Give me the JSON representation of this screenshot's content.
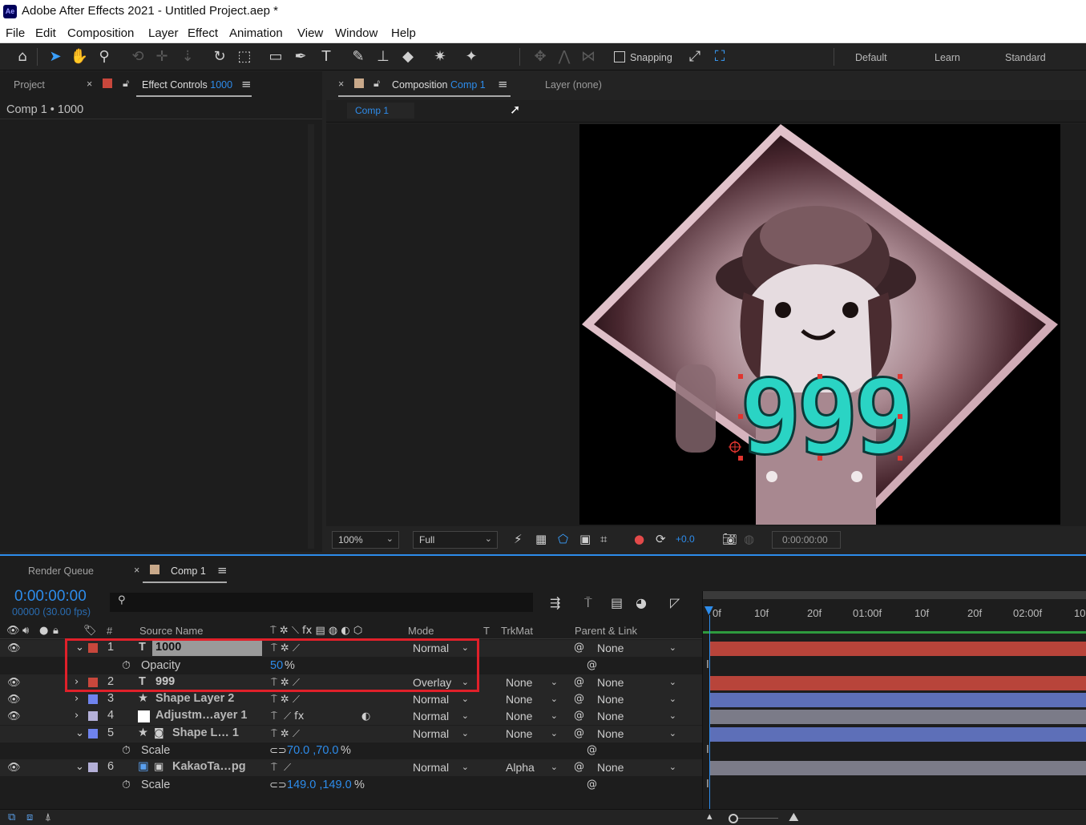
{
  "app": {
    "title": "Adobe After Effects 2021 - Untitled Project.aep *",
    "icon_label": "Ae"
  },
  "menu": [
    "File",
    "Edit",
    "Composition",
    "Layer",
    "Effect",
    "Animation",
    "View",
    "Window",
    "Help"
  ],
  "toolbar": {
    "snapping_label": "Snapping",
    "workspaces": [
      "Default",
      "Learn",
      "Standard"
    ]
  },
  "left_panel": {
    "tab_project": "Project",
    "tab_effect_controls": "Effect Controls",
    "effect_controls_target": "1000",
    "content_title": "Comp 1 • 1000",
    "label_color": "#c8473c"
  },
  "comp_panel": {
    "tab_composition": "Composition",
    "comp_name": "Comp 1",
    "tab_layer": "Layer (none)",
    "subtab": "Comp 1",
    "zoom": "100%",
    "resolution": "Full",
    "exposure": "+0.0",
    "timecode": "0:00:00:00",
    "label_color": "#c9a98a",
    "overlay_text": "999"
  },
  "timeline": {
    "tab_render_queue": "Render Queue",
    "tab_comp": "Comp 1",
    "current_time": "0:00:00:00",
    "frame_info": "00000 (30.00 fps)",
    "search_placeholder": "",
    "columns": {
      "number": "#",
      "source_name": "Source Name",
      "mode": "Mode",
      "t": "T",
      "trkmat": "TrkMat",
      "parent": "Parent & Link"
    },
    "ruler": [
      "0f",
      "10f",
      "20f",
      "01:00f",
      "10f",
      "20f",
      "02:00f",
      "10"
    ],
    "layers": [
      {
        "num": "1",
        "type_icon": "T",
        "name": "1000",
        "mode": "Normal",
        "trkmat": "",
        "parent": "None",
        "color": "#c8473c",
        "expanded": true,
        "prop": {
          "name": "Opacity",
          "value": "50",
          "unit": "%"
        }
      },
      {
        "num": "2",
        "type_icon": "T",
        "name": "999",
        "mode": "Overlay",
        "trkmat": "None",
        "parent": "None",
        "color": "#c8473c",
        "expanded": false
      },
      {
        "num": "3",
        "type_icon": "★",
        "name": "Shape Layer 2",
        "mode": "Normal",
        "trkmat": "None",
        "parent": "None",
        "color": "#6f83ee",
        "expanded": false
      },
      {
        "num": "4",
        "type_icon": "□",
        "name": "Adjustm…ayer 1",
        "mode": "Normal",
        "trkmat": "None",
        "parent": "None",
        "color": "#b4b0d8",
        "expanded": false
      },
      {
        "num": "5",
        "type_icon": "★",
        "name": "Shape L… 1",
        "mode": "Normal",
        "trkmat": "None",
        "parent": "None",
        "color": "#6f83ee",
        "expanded": true,
        "prop": {
          "name": "Scale",
          "value": "70.0 ,70.0",
          "unit": "%"
        }
      },
      {
        "num": "6",
        "type_icon": "▣",
        "name": "KakaoTa…pg",
        "mode": "Normal",
        "trkmat": "Alpha",
        "parent": "None",
        "color": "#b4b0d8",
        "expanded": true,
        "prop": {
          "name": "Scale",
          "value": "149.0 ,149.0",
          "unit": "%"
        }
      }
    ]
  },
  "colors": {
    "accent": "#2d8ceb",
    "highlight_box": "#e0202a",
    "track_red": "#b8443a",
    "track_blue": "#5d6fb8",
    "track_gray": "#7b7b88"
  }
}
